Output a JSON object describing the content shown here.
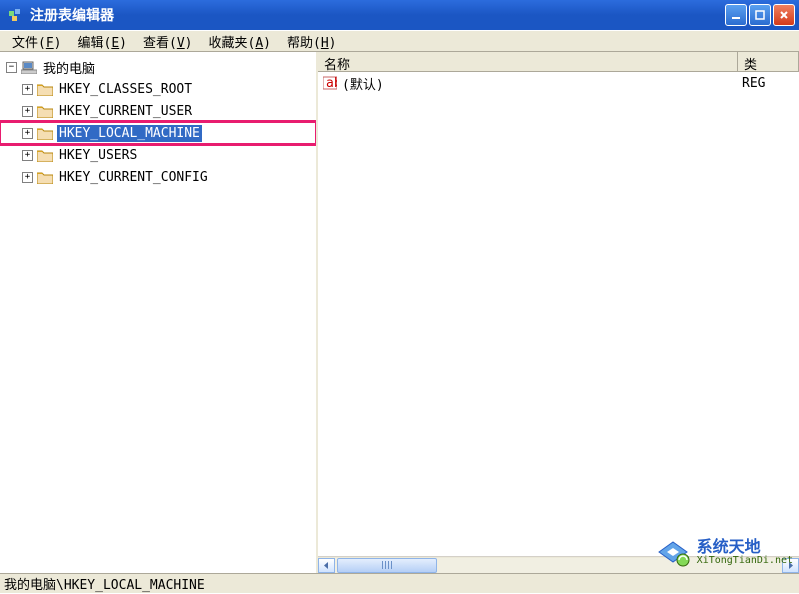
{
  "window": {
    "title": "注册表编辑器"
  },
  "menu": {
    "file": {
      "label": "文件",
      "hotkey": "F"
    },
    "edit": {
      "label": "编辑",
      "hotkey": "E"
    },
    "view": {
      "label": "查看",
      "hotkey": "V"
    },
    "fav": {
      "label": "收藏夹",
      "hotkey": "A"
    },
    "help": {
      "label": "帮助",
      "hotkey": "H"
    }
  },
  "tree": {
    "root": {
      "label": "我的电脑",
      "expanded": true
    },
    "items": [
      {
        "key": "hkcr",
        "label": "HKEY_CLASSES_ROOT",
        "selected": false,
        "highlighted": false
      },
      {
        "key": "hkcu",
        "label": "HKEY_CURRENT_USER",
        "selected": false,
        "highlighted": false
      },
      {
        "key": "hklm",
        "label": "HKEY_LOCAL_MACHINE",
        "selected": true,
        "highlighted": true
      },
      {
        "key": "hku",
        "label": "HKEY_USERS",
        "selected": false,
        "highlighted": false
      },
      {
        "key": "hkcc",
        "label": "HKEY_CURRENT_CONFIG",
        "selected": false,
        "highlighted": false
      }
    ]
  },
  "list": {
    "columns": {
      "name": "名称",
      "type": "类"
    },
    "rows": [
      {
        "name": "(默认)",
        "type": "REG"
      }
    ]
  },
  "status": {
    "path": "我的电脑\\HKEY_LOCAL_MACHINE"
  },
  "watermark": {
    "title": "系统天地",
    "sub": "XiTongTianDi.net"
  }
}
